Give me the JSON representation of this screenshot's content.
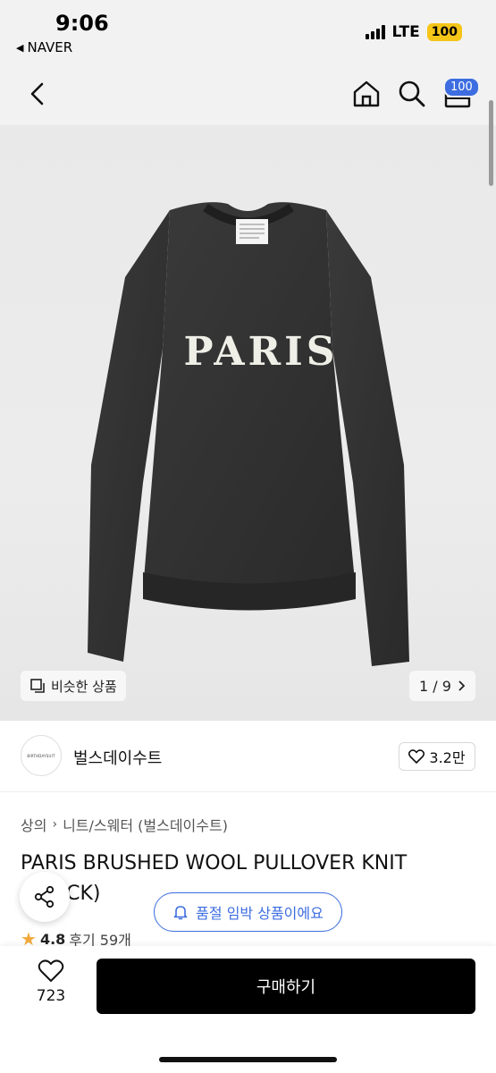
{
  "status_bar": {
    "time": "9:06",
    "back_app": "NAVER",
    "network": "LTE",
    "battery": "100"
  },
  "nav": {
    "cart_badge": "100"
  },
  "hero": {
    "print_text": "PARIS",
    "similar_label": "비슷한 상품",
    "pager": "1 / 9"
  },
  "brand": {
    "logo_text": "BIRTHDAYSUIT",
    "name": "벌스데이수트",
    "likes": "3.2만"
  },
  "breadcrumb": {
    "level1": "상의",
    "level2": "니트/스웨터 (벌스데이수트)"
  },
  "product": {
    "title": "PARIS BRUSHED WOOL PULLOVER KNIT (BLACK)",
    "rating": "4.8",
    "reviews": "후기 59개"
  },
  "notice": {
    "soldout": "품절 임박 상품이에요"
  },
  "bottom": {
    "wish_count": "723",
    "buy_label": "구매하기"
  },
  "colors": {
    "accent": "#3d6de0",
    "battery": "#f5c518",
    "buy_button": "#000000",
    "star": "#f2a93b"
  }
}
